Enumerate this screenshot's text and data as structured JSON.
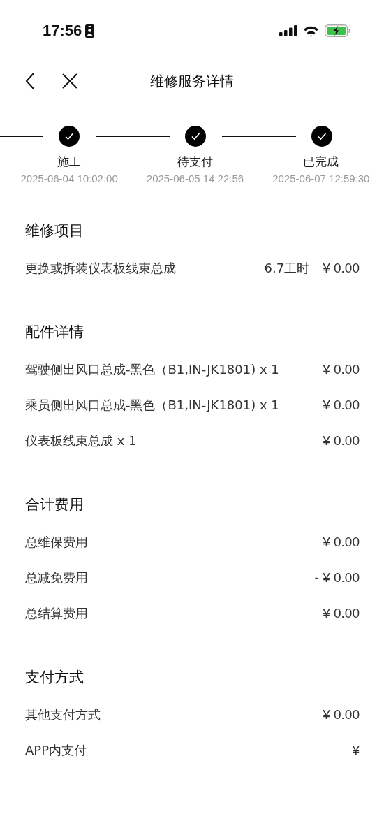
{
  "status_bar": {
    "time": "17:56"
  },
  "nav": {
    "title": "维修服务详情"
  },
  "steps": [
    {
      "label": "施工",
      "time": "2025-06-04 10:02:00",
      "done": true
    },
    {
      "label": "待支付",
      "time": "2025-06-05 14:22:56",
      "done": true
    },
    {
      "label": "已完成",
      "time": "2025-06-07 12:59:30",
      "done": true
    }
  ],
  "sections": [
    {
      "title": "维修项目",
      "rows": [
        {
          "name": "更换或拆装仪表板线束总成",
          "hours": "6.7工时",
          "value": "¥ 0.00"
        }
      ]
    },
    {
      "title": "配件详情",
      "rows": [
        {
          "name": "驾驶侧出风口总成-黑色（B1,IN-JK1801) x 1",
          "value": "¥ 0.00"
        },
        {
          "name": "乘员侧出风口总成-黑色（B1,IN-JK1801) x 1",
          "value": "¥ 0.00"
        },
        {
          "name": "仪表板线束总成 x 1",
          "value": "¥ 0.00"
        }
      ]
    },
    {
      "title": "合计费用",
      "rows": [
        {
          "name": "总维保费用",
          "value": "¥ 0.00"
        },
        {
          "name": "总减免费用",
          "value": "- ¥ 0.00"
        },
        {
          "name": "总结算费用",
          "value": "¥ 0.00"
        }
      ]
    },
    {
      "title": "支付方式",
      "rows": [
        {
          "name": "其他支付方式",
          "value": "¥ 0.00"
        },
        {
          "name": "APP内支付",
          "value": "¥"
        }
      ]
    }
  ]
}
